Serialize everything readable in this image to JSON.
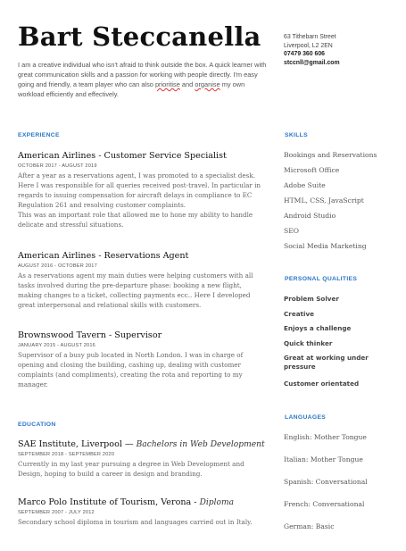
{
  "header": {
    "name": "Bart Steccanella",
    "intro": [
      {
        "text": "I am a creative individual who isn't afraid to think outside the box. A quick learner with great communication skills and a passion for working with people directly. I'm easy going and friendly, a team player who can also ",
        "u": false
      },
      {
        "text": "prioritise",
        "u": true
      },
      {
        "text": " and ",
        "u": false
      },
      {
        "text": "organise",
        "u": true
      },
      {
        "text": " my own workload efficiently and effectively.",
        "u": false
      }
    ]
  },
  "contact": {
    "street": "63 Tithebarn Street",
    "city": "Liverpool, L2 2EN",
    "phone": "07479 360 606",
    "email": "stccnll@gmail.com"
  },
  "experience": {
    "title": "EXPERIENCE",
    "jobs": [
      {
        "role": "American Airlines - Customer Service Specialist",
        "dates": "OCTOBER 2017 - AUGUST 2019",
        "desc": [
          "After a year as a reservations agent, I was promoted to a specialist desk. Here I was responsible for all queries received  post-travel. In particular in regards to issuing compensation for aircraft delays in compliance to EC Regulation 261 and resolving customer complaints.",
          "This was an important role that allowed me to hone my ability to handle delicate and stressful situations."
        ]
      },
      {
        "role": "American Airlines - Reservations Agent",
        "dates": "AUGUST 2016 - OCTOBER 2017",
        "desc": [
          "As a reservations agent my main duties were helping customers with all tasks involved during the  pre-departure phase:  booking a new flight, making changes to a ticket, collecting payments ecc.. Here I developed great interpersonal and relational skills with customers."
        ]
      },
      {
        "role": "Brownswood Tavern - Supervisor",
        "dates": "JANUARY 2015 - AUGUST 2016",
        "desc": [
          "Supervisor of a busy pub located in North London. I was in charge of opening and closing the building, cashing up, dealing with customer complaints (and compliments), creating the rota and reporting to my manager."
        ]
      }
    ]
  },
  "education": {
    "title": "EDUCATION",
    "items": [
      {
        "school": "SAE Institute, Liverpool",
        "sep": " — ",
        "degree": "Bachelors in Web Development",
        "dates": "SEPTEMBER 2018 - SEPTEMBER 2020",
        "desc": "Currently in my last year pursuing a degree in Web Development and Design, hoping to build a career in design and branding."
      },
      {
        "school": "Marco Polo Institute of Tourism, Verona",
        "sep": " - ",
        "degree": "Diploma",
        "dates": "SEPTEMBER 2007 - JULY 2012",
        "desc": "Secondary school diploma in tourism and languages carried out in Italy."
      }
    ]
  },
  "skills": {
    "title": "SKILLS",
    "items": [
      "Bookings and Reservations",
      "Microsoft Office",
      "Adobe Suite",
      "HTML, CSS, JavaScript",
      "Android Studio",
      "SEO",
      "Social Media Marketing"
    ]
  },
  "qualities": {
    "title": "PERSONAL QUALITIES",
    "items": [
      "Problem Solver",
      "Creative",
      "Enjoys a challenge",
      "Quick thinker",
      "Great at working under pressure",
      "Customer orientated"
    ]
  },
  "languages": {
    "title": "LANGUAGES",
    "items": [
      "English: Mother Tongue",
      "Italian: Mother Tongue",
      "Spanish: Conversational",
      "French: Conversational",
      "German: Basic"
    ]
  },
  "colors": {
    "accent": "#2a76c6",
    "heading": "#111111",
    "body_text": "#666666"
  }
}
